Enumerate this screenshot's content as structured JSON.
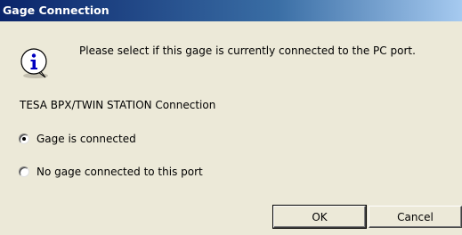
{
  "dialog": {
    "title": "Gage Connection",
    "message": "Please select if this gage is currently connected to the PC port.",
    "section_label": "TESA BPX/TWIN STATION Connection",
    "options": [
      {
        "label": "Gage is connected",
        "checked": true
      },
      {
        "label": "No gage connected to this port",
        "checked": false
      }
    ],
    "buttons": {
      "ok": "OK",
      "cancel": "Cancel"
    }
  },
  "icons": {
    "info": "info-icon"
  },
  "colors": {
    "titlebar_start": "#0a246a",
    "titlebar_end": "#a6caf0",
    "background": "#ece9d8"
  }
}
